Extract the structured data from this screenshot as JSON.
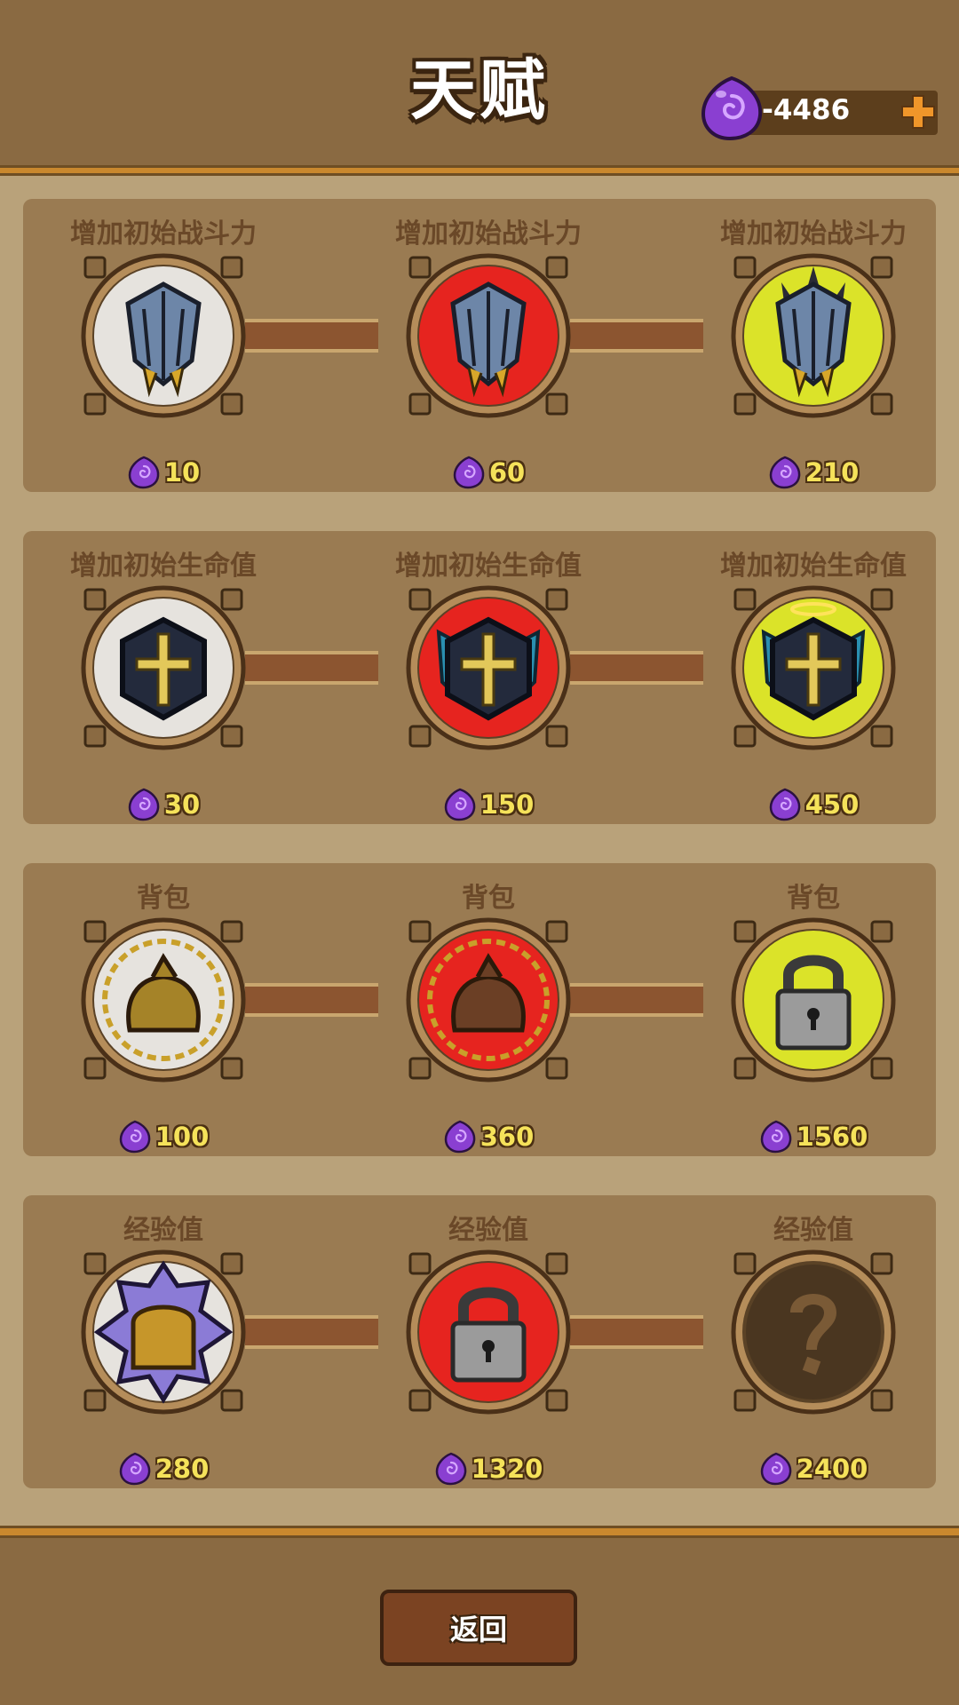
{
  "header": {
    "title": "天赋",
    "currency": {
      "icon": "purple-gem-icon",
      "value": "-4486",
      "add_icon": "plus-icon"
    }
  },
  "colors": {
    "tier1_glow": "#ffffff",
    "tier2_glow": "#ff1f1f",
    "tier3_glow": "#f2ff2a",
    "gem": "#8a3fd1",
    "cost_text": "#f5e25a"
  },
  "rows": [
    {
      "slots": [
        {
          "title": "增加初始战斗力",
          "icon": "shield-icon",
          "tier": 1,
          "locked": false,
          "cost": "10"
        },
        {
          "title": "增加初始战斗力",
          "icon": "shield-icon",
          "tier": 2,
          "locked": false,
          "cost": "60"
        },
        {
          "title": "增加初始战斗力",
          "icon": "spiked-shield-icon",
          "tier": 3,
          "locked": false,
          "cost": "210"
        }
      ]
    },
    {
      "slots": [
        {
          "title": "增加初始生命值",
          "icon": "cross-icon",
          "tier": 1,
          "locked": false,
          "cost": "30"
        },
        {
          "title": "增加初始生命值",
          "icon": "winged-cross-icon",
          "tier": 2,
          "locked": false,
          "cost": "150"
        },
        {
          "title": "增加初始生命值",
          "icon": "haloed-cross-icon",
          "tier": 3,
          "locked": false,
          "cost": "450"
        }
      ]
    },
    {
      "slots": [
        {
          "title": "背包",
          "icon": "sack-icon",
          "tier": 1,
          "locked": false,
          "cost": "100"
        },
        {
          "title": "背包",
          "icon": "backpack-icon",
          "tier": 2,
          "locked": false,
          "cost": "360"
        },
        {
          "title": "背包",
          "icon": "padlock-icon",
          "tier": 3,
          "locked": true,
          "cost": "1560"
        }
      ]
    },
    {
      "slots": [
        {
          "title": "经验值",
          "icon": "chest-icon",
          "tier": 1,
          "locked": false,
          "cost": "280"
        },
        {
          "title": "经验值",
          "icon": "padlock-icon",
          "tier": 2,
          "locked": true,
          "cost": "1320"
        },
        {
          "title": "经验值",
          "icon": "question-mark-icon",
          "tier": 0,
          "locked": true,
          "cost": "2400"
        }
      ]
    }
  ],
  "footer": {
    "back_label": "返回"
  }
}
